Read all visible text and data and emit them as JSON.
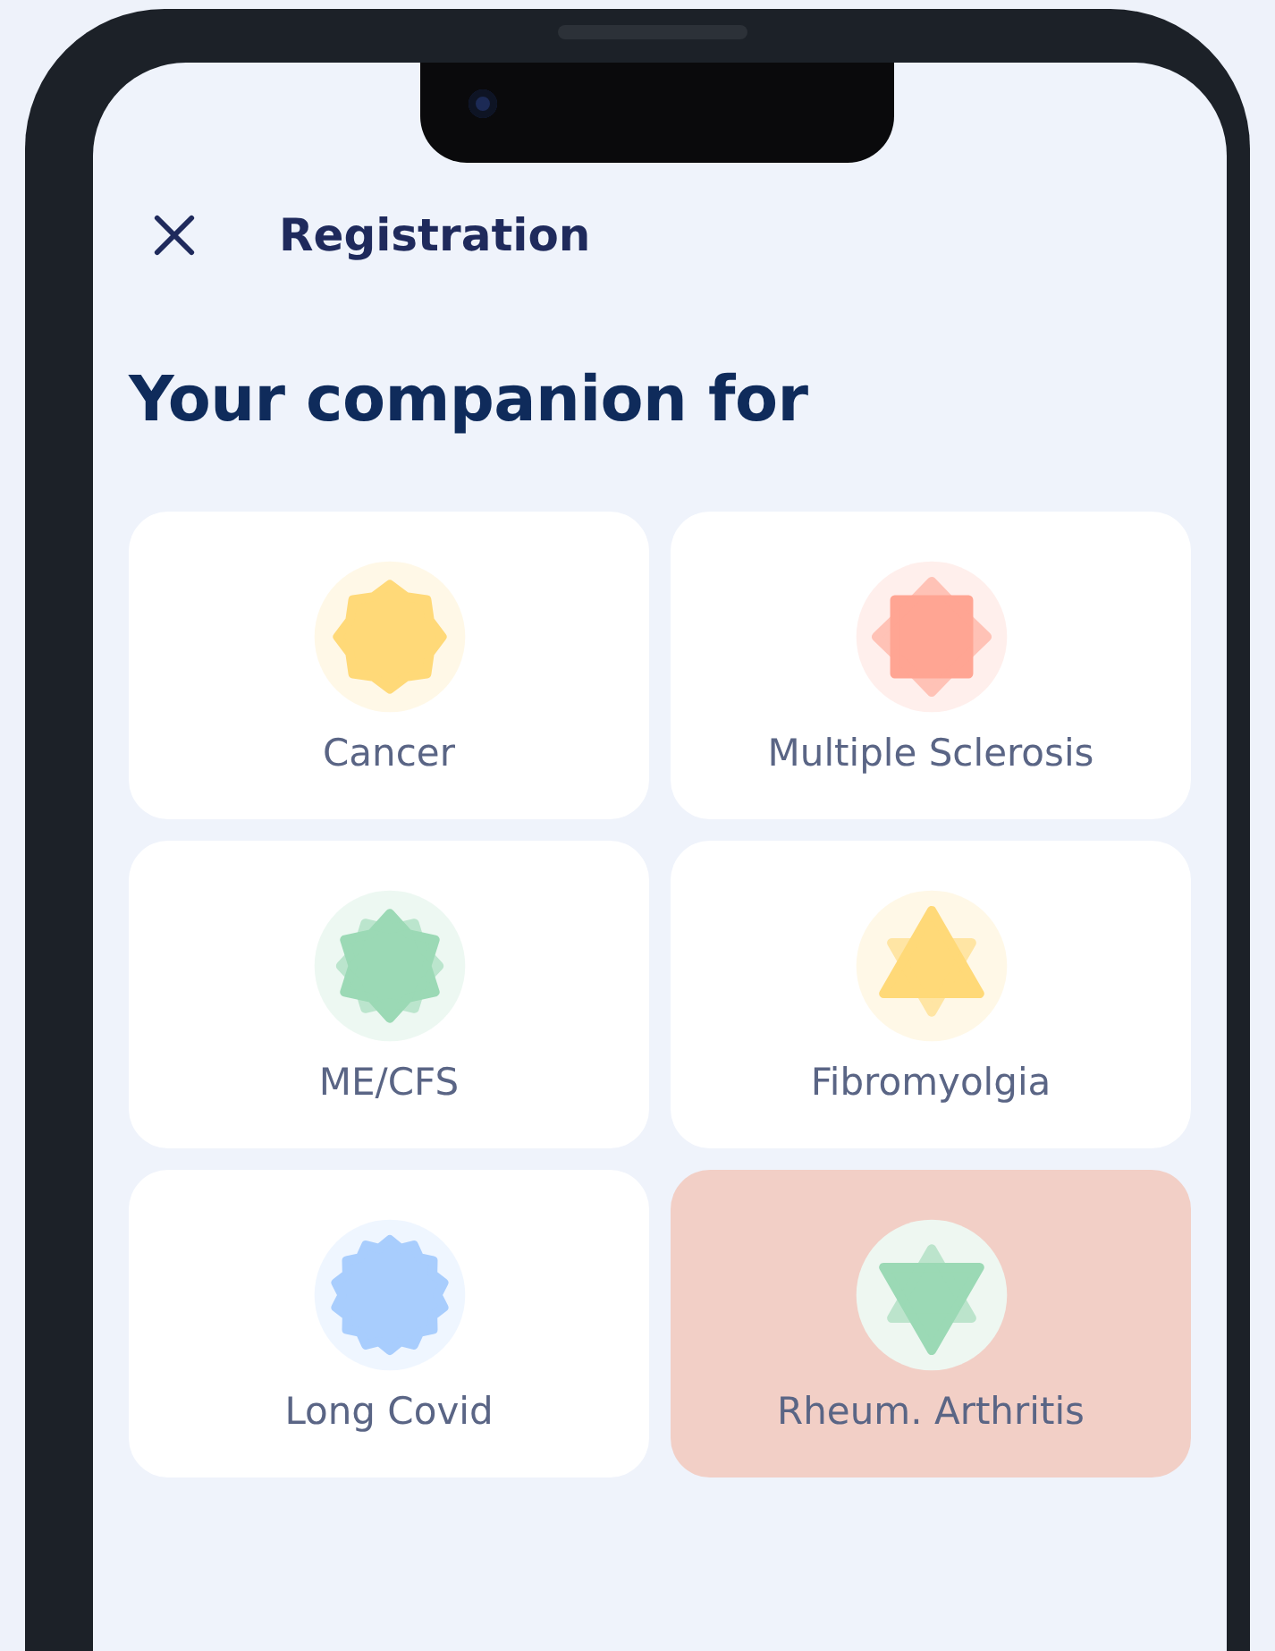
{
  "header": {
    "title": "Registration"
  },
  "heading": "Your companion for",
  "conditions": [
    {
      "label": "Cancer",
      "kind": "burst",
      "color": "#ffd978",
      "selected": false
    },
    {
      "label": "Multiple Sclerosis",
      "kind": "diamond",
      "color": "#ffa593",
      "selected": false
    },
    {
      "label": "ME/CFS",
      "kind": "flower",
      "color": "#9bd9b5",
      "selected": false
    },
    {
      "label": "Fibromyolgia",
      "kind": "triangle-up",
      "color": "#ffd978",
      "selected": false
    },
    {
      "label": "Long Covid",
      "kind": "scallop",
      "color": "#a8cdfd",
      "selected": false
    },
    {
      "label": "Rheum. Arthritis",
      "kind": "triangle-down",
      "color": "#9bd9b5",
      "selected": true
    }
  ]
}
